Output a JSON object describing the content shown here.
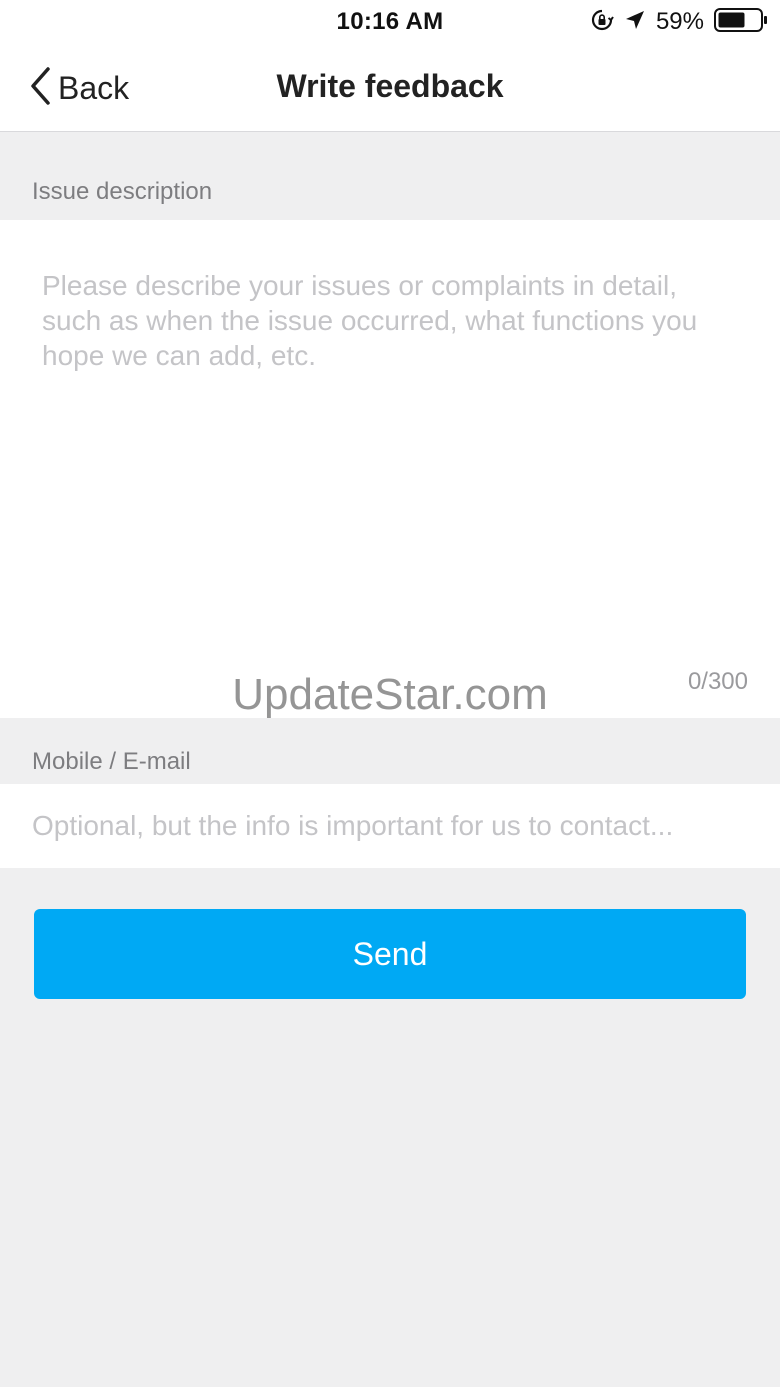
{
  "status_bar": {
    "time": "10:16 AM",
    "battery_percent": "59%",
    "icons": [
      "orientation-lock-icon",
      "location-arrow-icon",
      "battery-icon"
    ]
  },
  "nav": {
    "back_label": "Back",
    "back_icon": "chevron-left-icon",
    "title": "Write feedback"
  },
  "issue": {
    "section_label": "Issue description",
    "placeholder": "Please describe your issues or complaints in detail, such as when the issue occurred, what functions you hope we can add, etc.",
    "value": "",
    "counter": "0/300"
  },
  "contact": {
    "section_label": "Mobile / E-mail",
    "placeholder": "Optional, but the info is important for us to contact...",
    "value": ""
  },
  "send_label": "Send",
  "watermark": "UpdateStar.com",
  "colors": {
    "accent": "#00a9f4",
    "background": "#efeff0",
    "placeholder": "#c4c4c7",
    "label": "#7d7d80"
  }
}
